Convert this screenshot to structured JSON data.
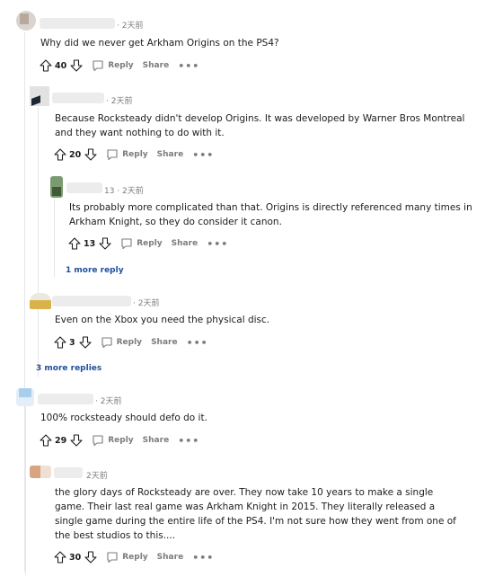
{
  "comments": [
    {
      "id": "c1",
      "time": "· 2天前",
      "text": "Why did we never get Arkham Origins on the PS4?",
      "votes": "40",
      "reply_label": "Reply",
      "share_label": "Share"
    },
    {
      "id": "c2",
      "time": "· 2天前",
      "text": "Because Rocksteady didn't develop Origins. It was developed by Warner Bros Montreal and they want nothing to do with it.",
      "votes": "20",
      "reply_label": "Reply",
      "share_label": "Share"
    },
    {
      "id": "c3",
      "time": "13 · 2天前",
      "text": "Its probably more complicated than that. Origins is directly referenced many times in Arkham Knight, so they do consider it canon.",
      "votes": "13",
      "reply_label": "Reply",
      "share_label": "Share"
    },
    {
      "id": "c4",
      "time": "· 2天前",
      "text": "Even on the Xbox you need the physical disc.",
      "votes": "3",
      "reply_label": "Reply",
      "share_label": "Share"
    },
    {
      "id": "c5",
      "time": "· 2天前",
      "text": "100% rocksteady should defo do it.",
      "votes": "29",
      "reply_label": "Reply",
      "share_label": "Share"
    },
    {
      "id": "c6",
      "time": "2天前",
      "text": "the glory days of Rocksteady are over. They now take 10 years to make a single game. Their last real game was Arkham Knight in 2015. They literally released a single game during the entire life of the PS4. I'm not sure how they went from one of the best studios to this....",
      "votes": "30",
      "reply_label": "Reply",
      "share_label": "Share"
    }
  ],
  "more_reply_1": "1 more reply",
  "more_replies_3": "3 more replies",
  "colors": {
    "link": "#1f4f9e",
    "muted": "#7c7c7c",
    "thread_line": "#e4e6e8"
  },
  "icons": [
    "upvote-icon",
    "downvote-icon",
    "comment-icon",
    "more-options-icon"
  ]
}
